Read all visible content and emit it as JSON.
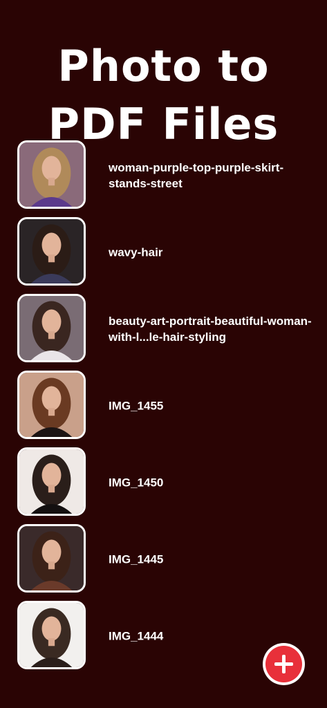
{
  "header": {
    "title_line1": "Photo to",
    "title_line2": "PDF Files"
  },
  "files": [
    {
      "name": "woman-purple-top-purple-skirt-stands-street",
      "thumb_icon": "photo-thumbnail-icon",
      "bg": "#8a6a7a",
      "hair": "#b08a5a",
      "outfit": "#5b3a8c"
    },
    {
      "name": "wavy-hair",
      "thumb_icon": "photo-thumbnail-icon",
      "bg": "#2a2426",
      "hair": "#2b1c16",
      "outfit": "#3a3a5a"
    },
    {
      "name": "beauty-art-portrait-beautiful-woman-with-l...le-hair-styling",
      "thumb_icon": "photo-thumbnail-icon",
      "bg": "#7a6c74",
      "hair": "#3a2620",
      "outfit": "#e9e4e8"
    },
    {
      "name": "IMG_1455",
      "thumb_icon": "photo-thumbnail-icon",
      "bg": "#c9a08a",
      "hair": "#6a3a22",
      "outfit": "#1c1414"
    },
    {
      "name": "IMG_1450",
      "thumb_icon": "photo-thumbnail-icon",
      "bg": "#efe9e6",
      "hair": "#2a1e1a",
      "outfit": "#141010"
    },
    {
      "name": "IMG_1445",
      "thumb_icon": "photo-thumbnail-icon",
      "bg": "#3a2a2a",
      "hair": "#3c2218",
      "outfit": "#6a3a2a"
    },
    {
      "name": "IMG_1444",
      "thumb_icon": "photo-thumbnail-icon",
      "bg": "#f2f0ee",
      "hair": "#3a2a22",
      "outfit": "#2a1e1a"
    }
  ],
  "fab": {
    "icon": "plus-icon",
    "color": "#e8303a"
  },
  "colors": {
    "background": "#2a0404",
    "text": "#ffffff"
  }
}
